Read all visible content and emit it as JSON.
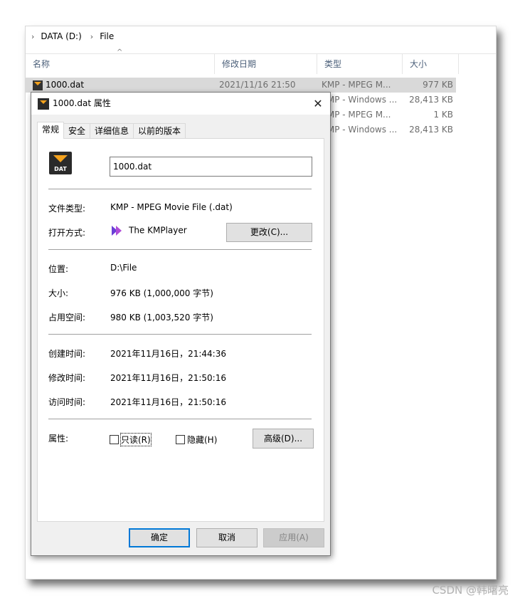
{
  "explorer": {
    "breadcrumb": [
      "DATA (D:)",
      "File"
    ],
    "columns": [
      "名称",
      "修改日期",
      "类型",
      "大小"
    ],
    "rows": [
      {
        "name": "1000.dat",
        "date": "2021/11/16 21:50",
        "type": "KMP - MPEG M...",
        "size": "977 KB"
      },
      {
        "name": "",
        "date": "",
        "type": "KMP - Windows ...",
        "size": "28,413 KB"
      },
      {
        "name": "",
        "date": "",
        "type": "KMP - MPEG M...",
        "size": "1 KB"
      },
      {
        "name": "",
        "date": "",
        "type": "KMP - Windows ...",
        "size": "28,413 KB"
      }
    ]
  },
  "dialog": {
    "title": "1000.dat 属性",
    "close_label": "✕",
    "tabs": [
      "常规",
      "安全",
      "详细信息",
      "以前的版本"
    ],
    "icon_text": "DAT",
    "filename": "1000.dat",
    "file_type_label": "文件类型:",
    "file_type_value": "KMP - MPEG Movie File (.dat)",
    "open_with_label": "打开方式:",
    "open_with_value": "The KMPlayer",
    "change_button": "更改(C)...",
    "location_label": "位置:",
    "location_value": "D:\\File",
    "size_label": "大小:",
    "size_value": "976 KB (1,000,000 字节)",
    "disk_size_label": "占用空间:",
    "disk_size_value": "980 KB (1,003,520 字节)",
    "created_label": "创建时间:",
    "created_value": "2021年11月16日，21:44:36",
    "modified_label": "修改时间:",
    "modified_value": "2021年11月16日，21:50:16",
    "accessed_label": "访问时间:",
    "accessed_value": "2021年11月16日，21:50:16",
    "attributes_label": "属性:",
    "readonly_label": "只读(R)",
    "hidden_label": "隐藏(H)",
    "advanced_button": "高级(D)...",
    "ok_button": "确定",
    "cancel_button": "取消",
    "apply_button": "应用(A)"
  },
  "watermark": "CSDN @韩曙亮"
}
